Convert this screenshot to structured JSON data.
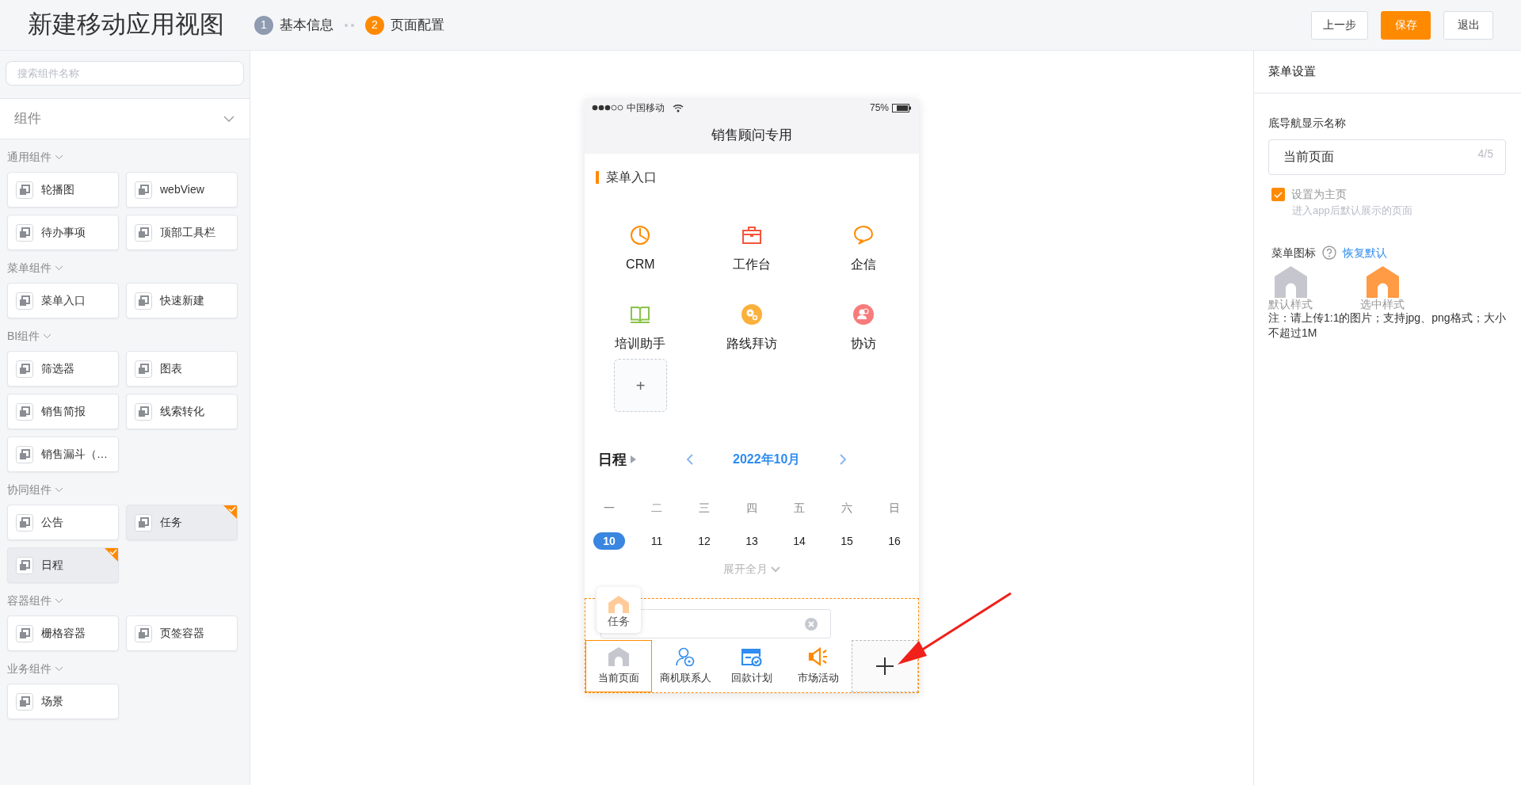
{
  "header": {
    "title": "新建移动应用视图",
    "steps": [
      {
        "number": "1",
        "label": "基本信息",
        "selected": false
      },
      {
        "number": "2",
        "label": "页面配置",
        "selected": true
      }
    ],
    "buttons": [
      {
        "label": "上一步",
        "kind": "default"
      },
      {
        "label": "保存",
        "kind": "primary"
      },
      {
        "label": "退出",
        "kind": "default"
      }
    ]
  },
  "sidebar": {
    "search": {
      "placeholder": "搜索组件名称"
    },
    "dropdown": "组件",
    "groups": [
      {
        "title": "通用组件",
        "items": [
          {
            "label": "轮播图",
            "selected": false
          },
          {
            "label": "webView",
            "selected": false
          },
          {
            "label": "待办事项",
            "selected": false
          },
          {
            "label": "顶部工具栏",
            "selected": false
          }
        ]
      },
      {
        "title": "菜单组件",
        "items": [
          {
            "label": "菜单入口",
            "selected": false
          },
          {
            "label": "快速新建",
            "selected": false
          }
        ]
      },
      {
        "title": "BI组件",
        "items": [
          {
            "label": "筛选器",
            "selected": false
          },
          {
            "label": "图表",
            "selected": false
          },
          {
            "label": "销售简报",
            "selected": false
          },
          {
            "label": "线索转化",
            "selected": false
          },
          {
            "label": "销售漏斗（…",
            "selected": false
          }
        ]
      },
      {
        "title": "协同组件",
        "items": [
          {
            "label": "公告",
            "selected": false
          },
          {
            "label": "任务",
            "selected": true
          },
          {
            "label": "日程",
            "selected": true
          }
        ]
      },
      {
        "title": "容器组件",
        "items": [
          {
            "label": "栅格容器",
            "selected": false
          },
          {
            "label": "页签容器",
            "selected": false
          }
        ]
      },
      {
        "title": "业务组件",
        "items": [
          {
            "label": "场景",
            "selected": false
          }
        ]
      }
    ]
  },
  "phone": {
    "status": {
      "carrier": "中国移动",
      "battery": "75%"
    },
    "title": "销售顾问专用",
    "menu_section": {
      "title": "菜单入口",
      "items": [
        {
          "label": "CRM",
          "color": "#ff8a00"
        },
        {
          "label": "工作台",
          "color": "#f5553b"
        },
        {
          "label": "企信",
          "color": "#ff8a00"
        },
        {
          "label": "培训助手",
          "color": "#8bc34a"
        },
        {
          "label": "路线拜访",
          "color": "#fbb03b"
        },
        {
          "label": "协访",
          "color": "#f77b7b"
        }
      ],
      "add_button": "+"
    },
    "calendar": {
      "title": "日程",
      "month": "2022年10月",
      "weekdays": [
        "一",
        "二",
        "三",
        "四",
        "五",
        "六",
        "日"
      ],
      "days": [
        {
          "label": "10",
          "selected": true
        },
        {
          "label": "11",
          "selected": false
        },
        {
          "label": "12",
          "selected": false
        },
        {
          "label": "13",
          "selected": false
        },
        {
          "label": "14",
          "selected": false
        },
        {
          "label": "15",
          "selected": false
        },
        {
          "label": "16",
          "selected": false
        }
      ],
      "expand": "展开全月"
    },
    "drag_tooltip": "任务",
    "bottom_nav": {
      "tabs": [
        {
          "label": "当前页面",
          "selected": true,
          "color": "#c6c6ce"
        },
        {
          "label": "商机联系人",
          "selected": false,
          "color": "#2f8cf0"
        },
        {
          "label": "回款计划",
          "selected": false,
          "color": "#2f8cf0"
        },
        {
          "label": "市场活动",
          "selected": false,
          "color": "#ff8a00"
        }
      ]
    }
  },
  "settings": {
    "title": "菜单设置",
    "name_label": "底导航显示名称",
    "name_value": "当前页面",
    "counter": "4/5",
    "home_checkbox": {
      "label": "设置为主页",
      "checked": true,
      "hint": "进入app后默认展示的页面"
    },
    "icon_label": "菜单图标",
    "reset_link": "恢复默认",
    "icon_styles": [
      {
        "label": "默认样式",
        "color": "#c6c6ce"
      },
      {
        "label": "选中样式",
        "color": "#ff9a45"
      }
    ],
    "note": "注：请上传1:1的图片；支持jpg、png格式；大小不超过1M"
  }
}
